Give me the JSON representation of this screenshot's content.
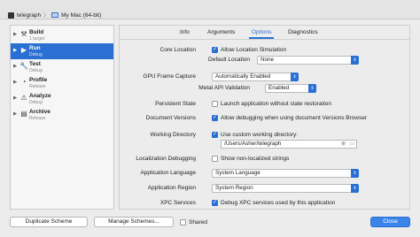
{
  "toolbar": {
    "scheme_name": "telegraph",
    "separator": "〉",
    "destination": "My Mac (64-bit)"
  },
  "sidebar": {
    "items": [
      {
        "name": "Build",
        "sub": "1 target",
        "icon": "hammer-icon",
        "glyph": "⚒",
        "selected": false
      },
      {
        "name": "Run",
        "sub": "Debug",
        "icon": "play-icon",
        "glyph": "▶",
        "selected": true
      },
      {
        "name": "Test",
        "sub": "Debug",
        "icon": "wrench-icon",
        "glyph": "🔧",
        "selected": false
      },
      {
        "name": "Profile",
        "sub": "Release",
        "icon": "gauge-icon",
        "glyph": "◔",
        "selected": false
      },
      {
        "name": "Analyze",
        "sub": "Debug",
        "icon": "analyze-icon",
        "glyph": "⚠",
        "selected": false
      },
      {
        "name": "Archive",
        "sub": "Release",
        "icon": "archive-icon",
        "glyph": "▤",
        "selected": false
      }
    ]
  },
  "tabs": [
    "Info",
    "Arguments",
    "Options",
    "Diagnostics"
  ],
  "active_tab": "Options",
  "options": {
    "core_location_label": "Core Location",
    "allow_location_sim": "Allow Location Simulation",
    "default_location_label": "Default Location",
    "default_location_value": "None",
    "gpu_frame_capture_label": "GPU Frame Capture",
    "gpu_frame_capture_value": "Automatically Enabled",
    "metal_api_label": "Metal API Validation",
    "metal_api_value": "Enabled",
    "persistent_state_label": "Persistent State",
    "persistent_state_cb": "Launch application without state restoration",
    "document_versions_label": "Document Versions",
    "document_versions_cb": "Allow debugging when using document Versions Browser",
    "working_directory_label": "Working Directory",
    "working_directory_cb": "Use custom working directory:",
    "working_directory_path": "/Users/Asher/telegraph",
    "localization_label": "Localization Debugging",
    "localization_cb": "Show non-localized strings",
    "app_language_label": "Application Language",
    "app_language_value": "System Language",
    "app_region_label": "Application Region",
    "app_region_value": "System Region",
    "xpc_label": "XPC Services",
    "xpc_cb": "Debug XPC services used by this application"
  },
  "footer": {
    "duplicate": "Duplicate Scheme",
    "manage": "Manage Schemes...",
    "shared": "Shared",
    "close": "Close"
  },
  "colors": {
    "accent": "#2a6fd2",
    "sidebar_selected": "#2a6fd2",
    "close_button": "#3b85ea"
  }
}
